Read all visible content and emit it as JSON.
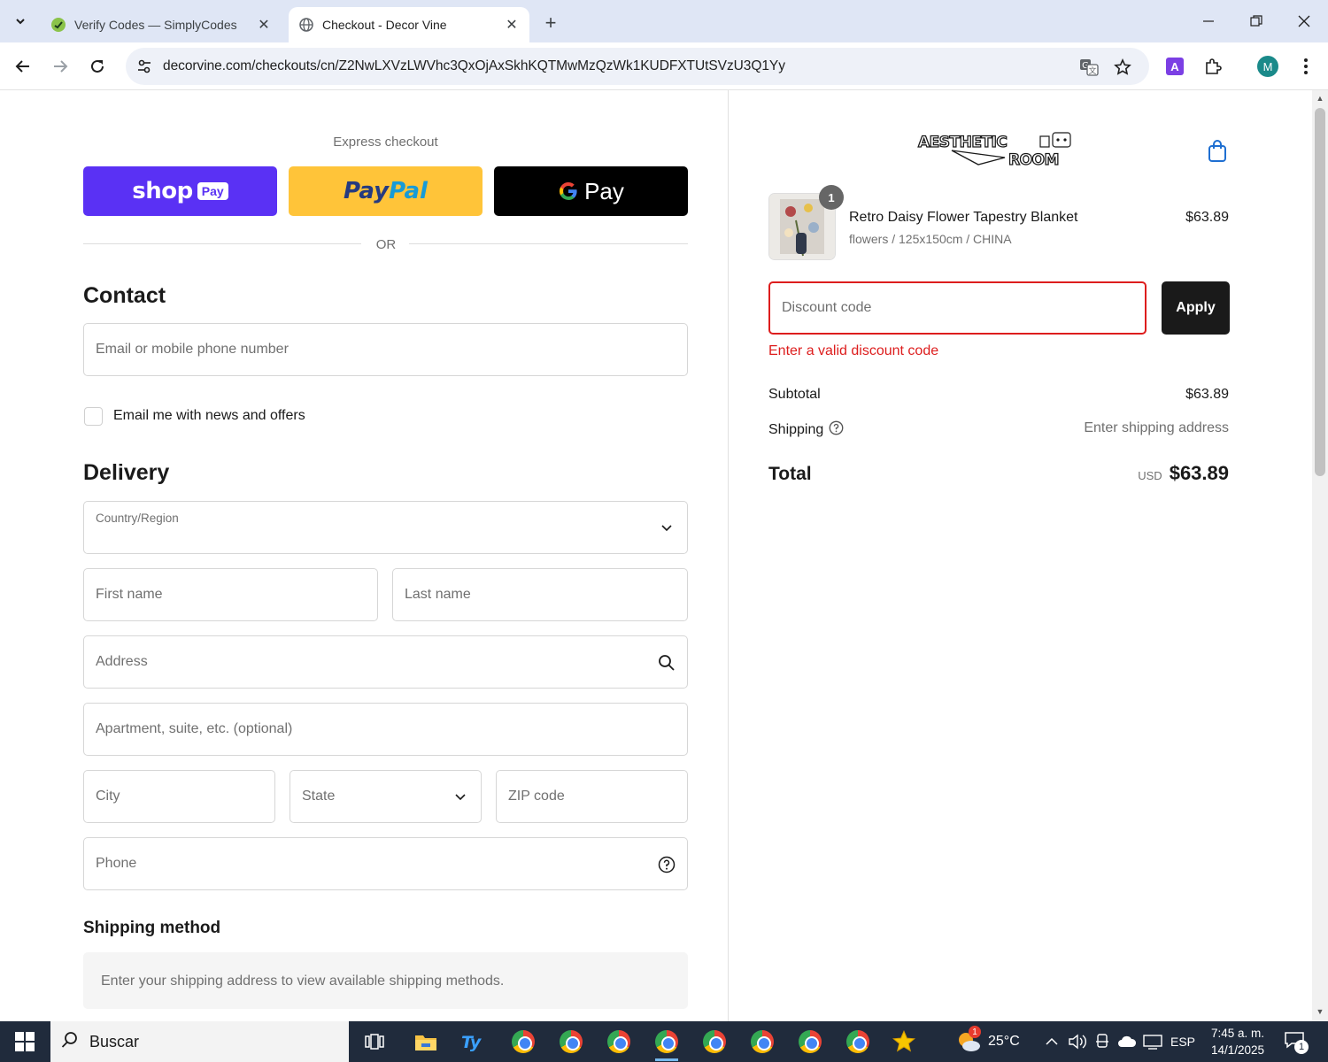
{
  "browser": {
    "tabs": [
      {
        "title": "Verify Codes — SimplyCodes",
        "active": false
      },
      {
        "title": "Checkout - Decor Vine",
        "active": true
      }
    ],
    "url": "decorvine.com/checkouts/cn/Z2NwLXVzLWVhc3QxOjAxSkhKQTMwMzQzWk1KUDFXTUtSVzU3Q1Yy",
    "profile_initial": "M",
    "extension_letter": "A"
  },
  "checkout": {
    "express_label": "Express checkout",
    "shop_pay": {
      "word": "shop",
      "badge": "Pay"
    },
    "paypal": {
      "part1": "Pay",
      "part2": "Pal"
    },
    "gpay": {
      "word": "Pay"
    },
    "or_label": "OR",
    "contact": {
      "heading": "Contact",
      "email_placeholder": "Email or mobile phone number",
      "newsletter_label": "Email me with news and offers"
    },
    "delivery": {
      "heading": "Delivery",
      "country_label": "Country/Region",
      "first_name": "First name",
      "last_name": "Last name",
      "address": "Address",
      "apartment": "Apartment, suite, etc. (optional)",
      "city": "City",
      "state": "State",
      "zip": "ZIP code",
      "phone": "Phone"
    },
    "shipping_method": {
      "heading": "Shipping method",
      "note": "Enter your shipping address to view available shipping methods."
    }
  },
  "summary": {
    "logo_text": [
      "AESTHETIC",
      "ROOM"
    ],
    "item": {
      "quantity": "1",
      "name": "Retro Daisy Flower Tapestry Blanket",
      "variant": "flowers / 125x150cm / CHINA",
      "price": "$63.89"
    },
    "discount_placeholder": "Discount code",
    "apply_label": "Apply",
    "discount_error": "Enter a valid discount code",
    "subtotal_label": "Subtotal",
    "subtotal_value": "$63.89",
    "shipping_label": "Shipping",
    "shipping_value": "Enter shipping address",
    "total_label": "Total",
    "total_currency": "USD",
    "total_value": "$63.89"
  },
  "taskbar": {
    "search_label": "Buscar",
    "weather": "25°C",
    "weather_badge": "1",
    "language": "ESP",
    "time": "7:45 a. m.",
    "date": "14/1/2025",
    "notification_count": "1"
  },
  "colors": {
    "shop_pay": "#5a31f4",
    "paypal": "#ffc439",
    "error": "#dd1d1d",
    "taskbar": "#202b3c"
  }
}
